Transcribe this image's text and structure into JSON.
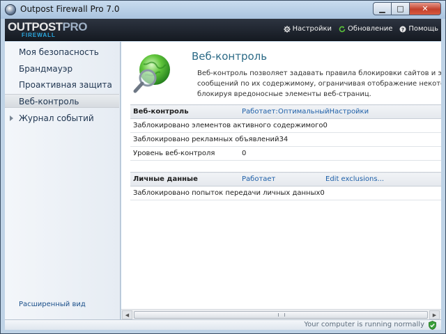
{
  "window": {
    "title": "Outpost Firewall Pro 7.0",
    "minimize": "▁",
    "maximize": "□",
    "close": "✕"
  },
  "logo": {
    "main": "OUTPOST",
    "pro": "PRO",
    "sub": "FIREWALL"
  },
  "header": {
    "settings_label": "Настройки",
    "update_label": "Обновление",
    "help_label": "Помощь"
  },
  "sidebar": {
    "items": [
      {
        "label": "Моя безопасность"
      },
      {
        "label": "Брандмауэр"
      },
      {
        "label": "Проактивная защита"
      },
      {
        "label": "Веб-контроль"
      },
      {
        "label": "Журнал событий"
      }
    ],
    "active_index": 3,
    "advanced_view": "Расширенный вид"
  },
  "page": {
    "title": "Веб-контроль",
    "description_lines": [
      "Веб-контроль позволяет задавать правила блокировки сайтов и электронных",
      "сообщений по их содержимому, ограничивая отображение некоторых сайтов и",
      "блокируя вредоносные элементы веб-страниц."
    ]
  },
  "web_control": {
    "header": "Веб-контроль",
    "status": "Работает:",
    "level": "Оптимальный",
    "settings_link": "Настройки",
    "rows": [
      {
        "label": "Заблокировано элементов активного содержимого",
        "value": "0"
      },
      {
        "label": "Заблокировано рекламных объявлений",
        "value": "34"
      },
      {
        "label": "Уровень веб-контроля",
        "value": "0"
      }
    ]
  },
  "personal_data": {
    "header": "Личные данные",
    "status": "Работает",
    "exclusions_link": "Edit exclusions...",
    "rows": [
      {
        "label": "Заблокировано попыток передачи личных данных",
        "value": "0"
      }
    ]
  },
  "status": {
    "text": "Your computer is running normally"
  },
  "colors": {
    "accent": "#2b6a86",
    "link": "#1d5fa8",
    "header_bg": "#1d232d",
    "ok_green": "#3aa13a"
  }
}
